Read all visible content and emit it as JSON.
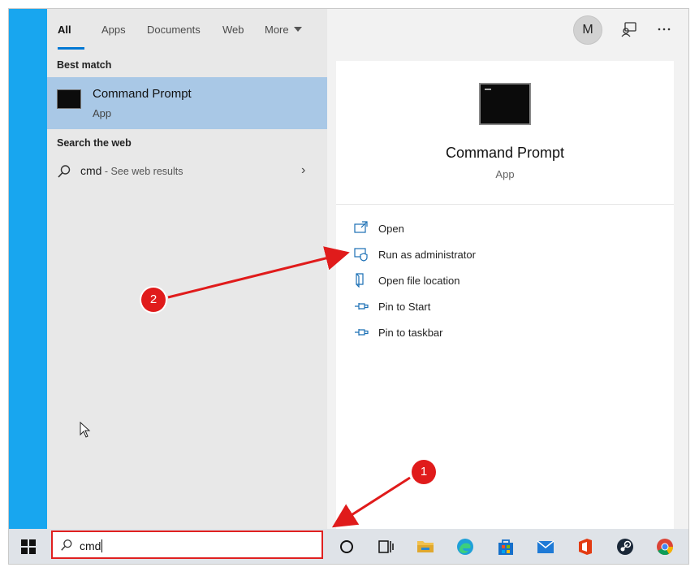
{
  "tabs": [
    {
      "label": "All",
      "active": true
    },
    {
      "label": "Apps"
    },
    {
      "label": "Documents"
    },
    {
      "label": "Web"
    },
    {
      "label": "More"
    }
  ],
  "header": {
    "avatar_initial": "M"
  },
  "best_match": {
    "section_label": "Best match",
    "title": "Command Prompt",
    "subtitle": "App"
  },
  "web": {
    "section_label": "Search the web",
    "query": "cmd",
    "suffix": " - See web results"
  },
  "detail": {
    "title": "Command Prompt",
    "subtitle": "App",
    "actions": [
      {
        "label": "Open",
        "icon": "open-icon"
      },
      {
        "label": "Run as administrator",
        "icon": "shield-icon"
      },
      {
        "label": "Open file location",
        "icon": "file-location-icon"
      },
      {
        "label": "Pin to Start",
        "icon": "pin-icon"
      },
      {
        "label": "Pin to taskbar",
        "icon": "pin-icon"
      }
    ]
  },
  "taskbar": {
    "search_value": "cmd",
    "apps": [
      "cortana-icon",
      "task-view-icon",
      "file-explorer-icon",
      "edge-icon",
      "store-icon",
      "mail-icon",
      "office-icon",
      "steam-icon",
      "chrome-icon"
    ]
  },
  "annotations": [
    {
      "label": "1"
    },
    {
      "label": "2"
    }
  ],
  "colors": {
    "accent": "#0078d4",
    "selection": "#a9c8e6",
    "annotation": "#e01b1b",
    "start_strip": "#18a6ef"
  }
}
